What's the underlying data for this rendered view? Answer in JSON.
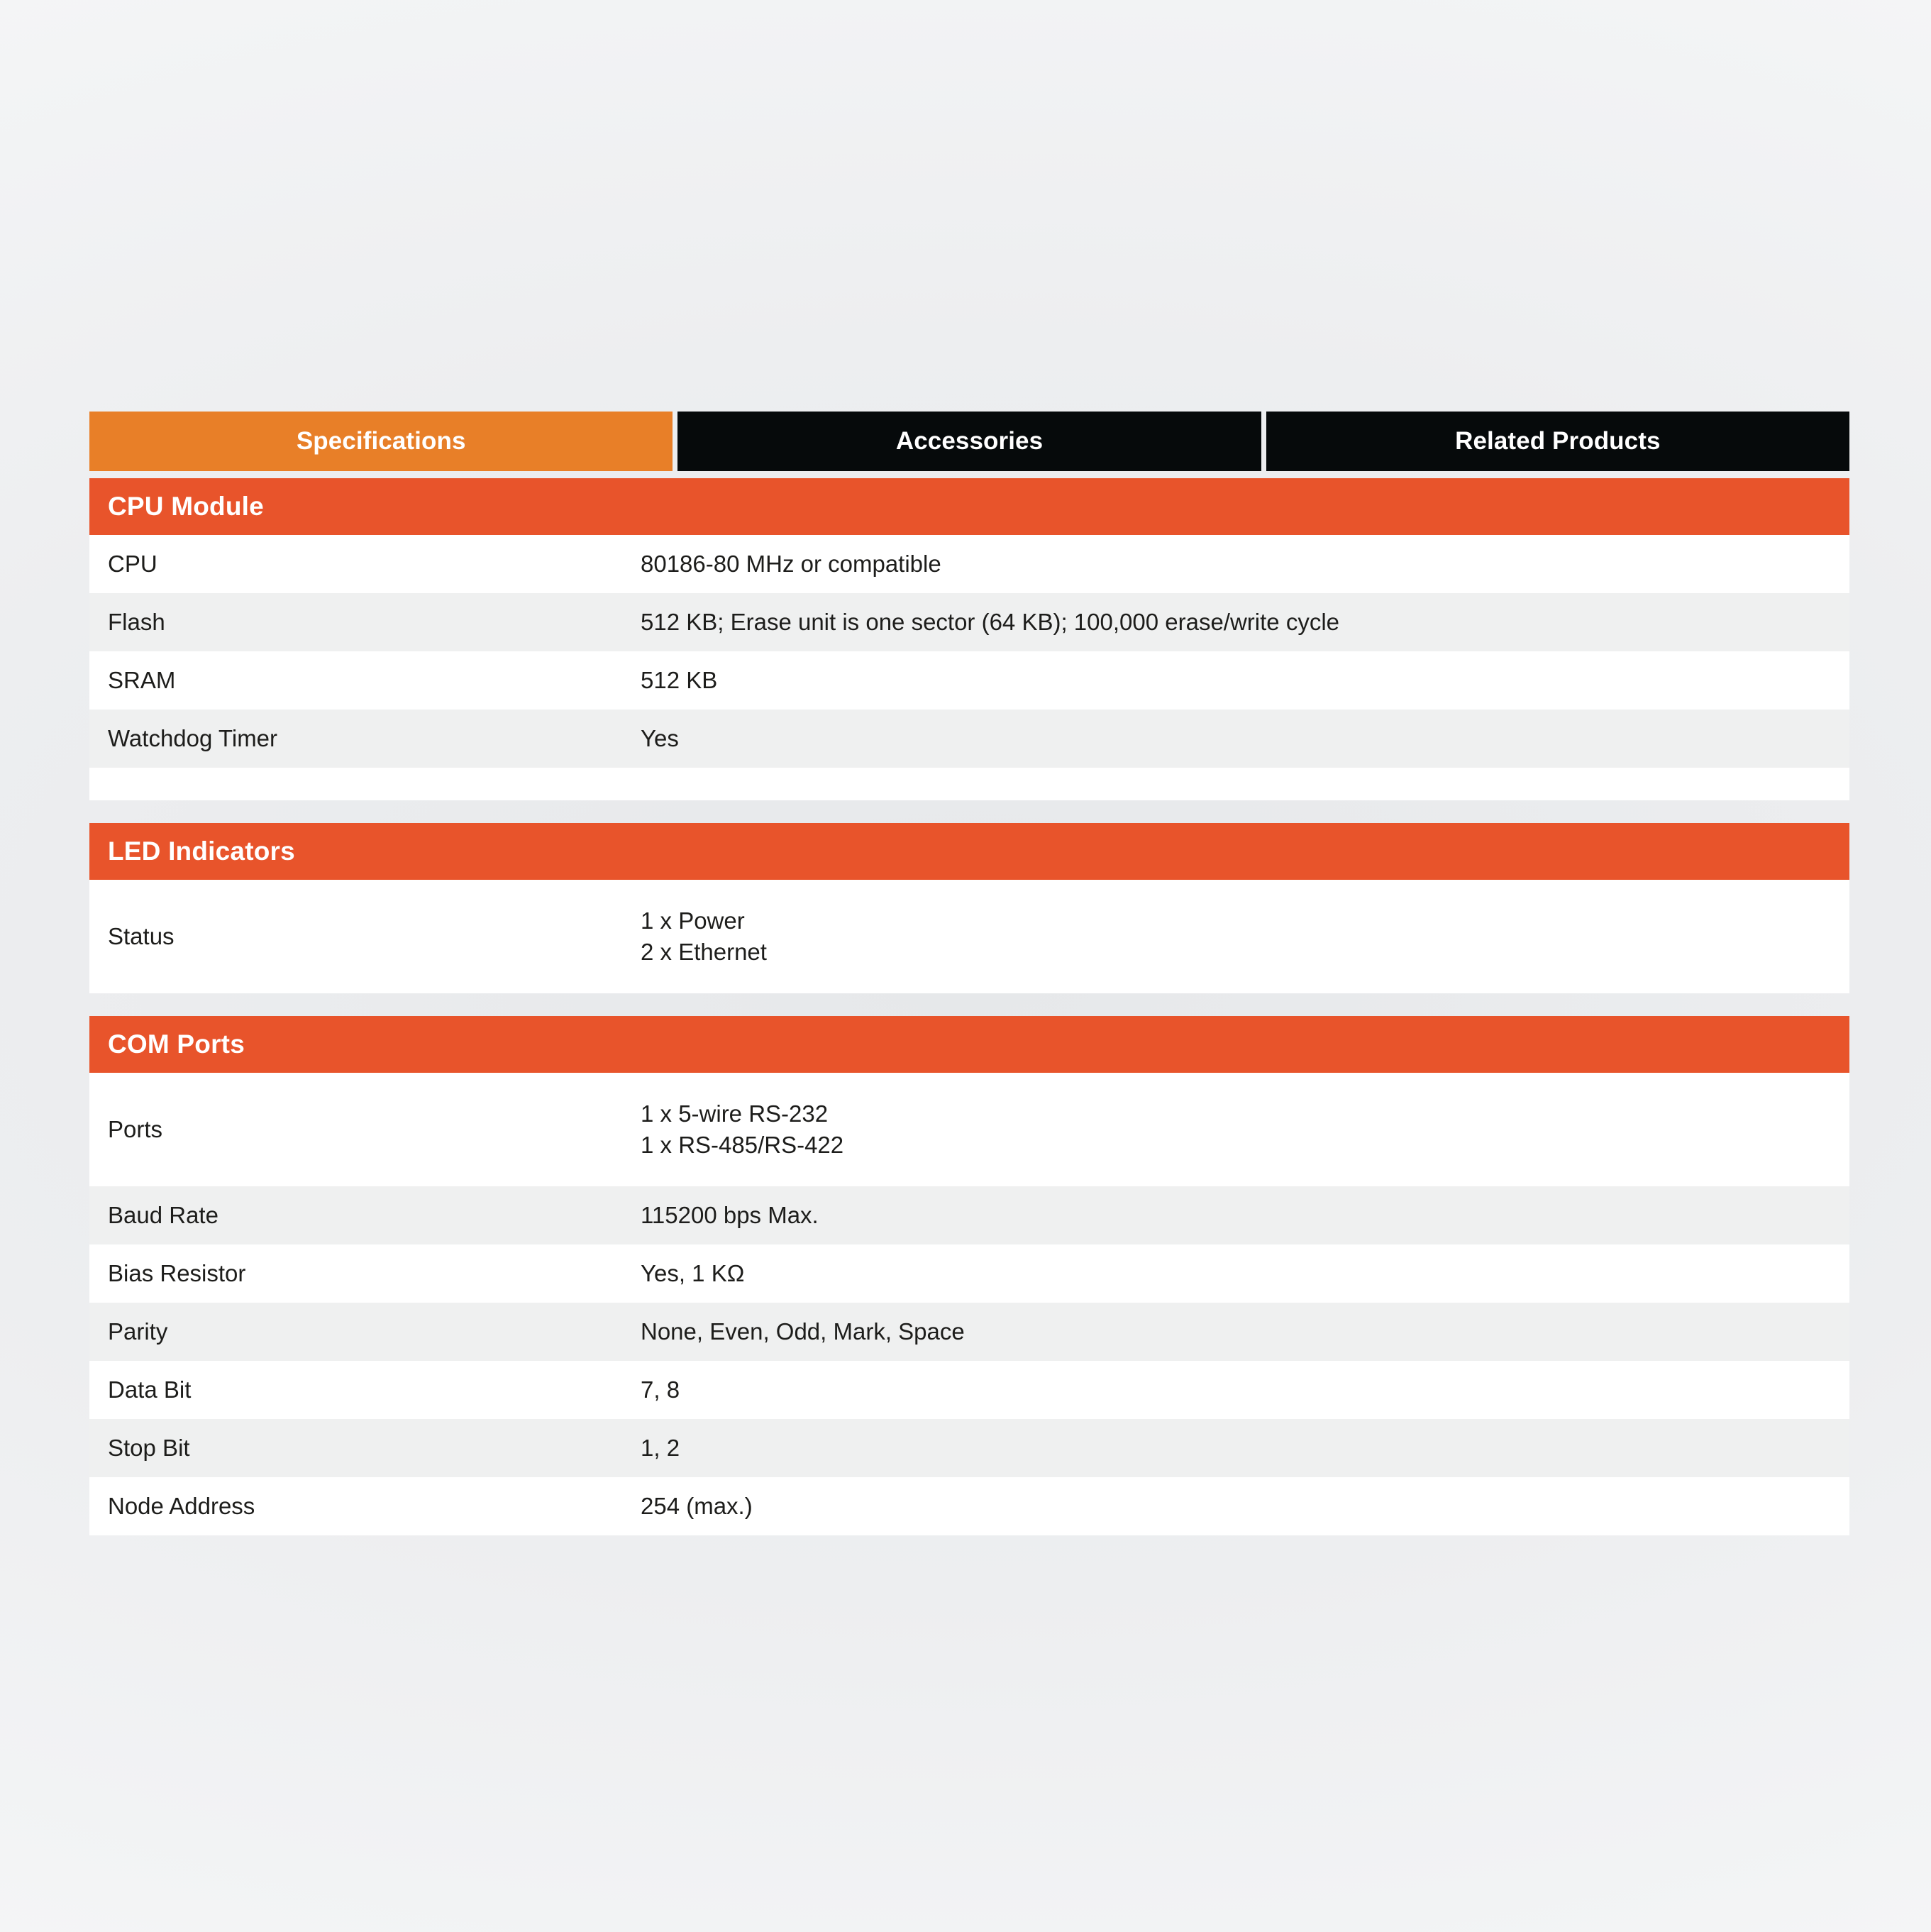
{
  "tabs": [
    {
      "label": "Specifications",
      "state": "active"
    },
    {
      "label": "Accessories",
      "state": "inactive"
    },
    {
      "label": "Related Products",
      "state": "inactive"
    }
  ],
  "colors": {
    "tab_active_bg": "#e87f28",
    "tab_inactive_bg": "#060a0b",
    "section_header_bg": "#e8542b",
    "row_white": "#ffffff",
    "row_gray": "#eff0f0",
    "text": "#1d1d1b",
    "page_bg": "#f3f4f5"
  },
  "sections": [
    {
      "title": "CPU Module",
      "rows": [
        {
          "label": "CPU",
          "value": "80186-80 MHz or compatible",
          "band": "white"
        },
        {
          "label": "Flash",
          "value": "512 KB; Erase unit is one sector (64 KB); 100,000 erase/write cycle",
          "band": "gray"
        },
        {
          "label": "SRAM",
          "value": "512 KB",
          "band": "white"
        },
        {
          "label": "Watchdog Timer",
          "value": "Yes",
          "band": "gray"
        }
      ]
    },
    {
      "title": "LED Indicators",
      "rows": [
        {
          "label": "Status",
          "value": "1 x Power\n2 x Ethernet",
          "band": "white",
          "tall": true
        }
      ]
    },
    {
      "title": "COM Ports",
      "rows": [
        {
          "label": "Ports",
          "value": "1 x 5-wire RS-232\n1 x RS-485/RS-422",
          "band": "white",
          "tall": true
        },
        {
          "label": "Baud Rate",
          "value": "115200 bps Max.",
          "band": "gray"
        },
        {
          "label": "Bias Resistor",
          "value": "Yes, 1 KΩ",
          "band": "white"
        },
        {
          "label": "Parity",
          "value": "None, Even, Odd, Mark, Space",
          "band": "gray"
        },
        {
          "label": "Data Bit",
          "value": "7, 8",
          "band": "white"
        },
        {
          "label": "Stop Bit",
          "value": "1, 2",
          "band": "gray"
        },
        {
          "label": "Node Address",
          "value": "254 (max.)",
          "band": "white"
        }
      ]
    }
  ]
}
